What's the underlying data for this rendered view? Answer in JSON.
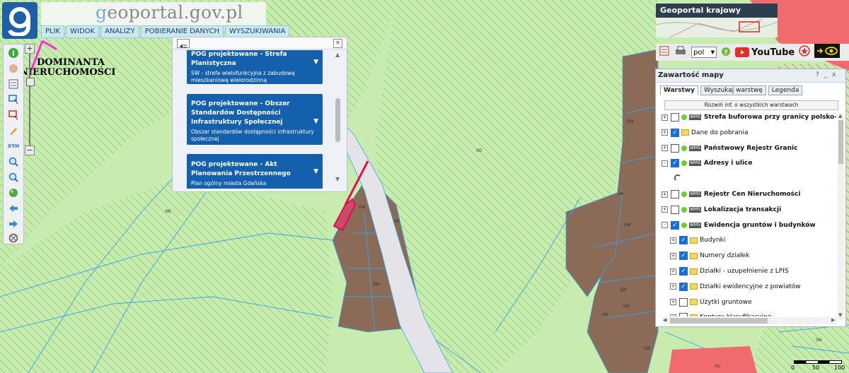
{
  "brand": {
    "prefix": "g",
    "name": "eoportal.gov.pl"
  },
  "menu": [
    "PLIK",
    "WIDOK",
    "ANALIZY",
    "POBIERANIE DANYCH",
    "WYSZUKIWANIA"
  ],
  "annotation": {
    "line1": "DOMINANTA",
    "line2": "NIERUCHOMOŚCI"
  },
  "popup": {
    "cards": [
      {
        "title": "POG projektowane - Strefa Planistyczna",
        "desc": "SW - strefa wielofunkcyjna z zabudową mieszkaniową wielorodzinną"
      },
      {
        "title": "POG projektowane - Obszar Standardów Dostępności Infrastruktury Społecznej",
        "desc": "Obszar standardów dostępności infrastruktury społecznej"
      },
      {
        "title": "POG projektowane - Akt Planowania Przestrzennego",
        "desc": "Plan ogólny miasta Gdańska"
      }
    ]
  },
  "map_labels": {
    "sn1": "SN",
    "sn2": "SN",
    "sn3": "SN",
    "so": "SO",
    "sw1": "SW",
    "sw2": "SW",
    "sw3": "SW",
    "sw4": "SW",
    "sw5": "SW",
    "sw6": "SW",
    "sw7": "SW",
    "sw8": "SW",
    "su": "SU",
    "sk": "SK"
  },
  "krajowy": {
    "label": "Geoportal krajowy"
  },
  "tools": {
    "lang": "pol",
    "youtube": "YouTube"
  },
  "panel": {
    "title": "Zawartość mapy",
    "controls": "? _ x",
    "tabs": [
      "Warstwy",
      "Wyszukaj warstwę",
      "Legenda"
    ],
    "expand_label": "Rozwiń inf. o wszystkich warstwach",
    "layers": [
      {
        "label": "Strefa buforowa przy granicy polsko-białoruskiej",
        "checked": false,
        "bold": true,
        "type": "wms",
        "indent": 0,
        "pm": "+"
      },
      {
        "label": "Dane do pobrania",
        "checked": true,
        "bold": false,
        "type": "folder",
        "indent": 0,
        "pm": "+"
      },
      {
        "label": "Państwowy Rejestr Granic",
        "checked": false,
        "bold": true,
        "type": "wms",
        "indent": 0,
        "pm": "+"
      },
      {
        "label": "Adresy i ulice",
        "checked": true,
        "bold": true,
        "type": "wms",
        "indent": 0,
        "pm": "-"
      },
      {
        "label": "",
        "checked": false,
        "bold": false,
        "type": "loading",
        "indent": 1,
        "pm": ""
      },
      {
        "label": "Rejestr Cen Nieruchomości",
        "checked": false,
        "bold": true,
        "type": "wms",
        "indent": 0,
        "pm": "+"
      },
      {
        "label": "Lokalizacja transakcji",
        "checked": false,
        "bold": true,
        "type": "wms",
        "indent": 0,
        "pm": "+"
      },
      {
        "label": "Ewidencja gruntów i budynków",
        "checked": true,
        "bold": true,
        "type": "wms",
        "indent": 0,
        "pm": "-"
      },
      {
        "label": "Budynki",
        "checked": true,
        "bold": false,
        "type": "folder",
        "indent": 1,
        "pm": "+"
      },
      {
        "label": "Numery działek",
        "checked": true,
        "bold": false,
        "type": "folder",
        "indent": 1,
        "pm": "+"
      },
      {
        "label": "Działki - uzupełnienie z LPIS",
        "checked": true,
        "bold": false,
        "type": "folder",
        "indent": 1,
        "pm": "+"
      },
      {
        "label": "Działki ewidencyjne z powiatów",
        "checked": true,
        "bold": false,
        "type": "folder",
        "indent": 1,
        "pm": "+"
      },
      {
        "label": "Użytki gruntowe",
        "checked": false,
        "bold": false,
        "type": "folder",
        "indent": 1,
        "pm": "+"
      },
      {
        "label": "Kontury klasyfikacyjne",
        "checked": false,
        "bold": false,
        "type": "folder",
        "indent": 1,
        "pm": "+"
      }
    ]
  },
  "scale": {
    "t0": "0",
    "t1": "50",
    "t2": "100"
  },
  "colors": {
    "map_green": "#c8ecb0",
    "parcel_brown": "#8a6b58",
    "zone_red": "#f06b6e",
    "road_gray": "#e4e4e8",
    "card_blue": "#1460ad",
    "boundary_blue": "#3aa3e6"
  }
}
